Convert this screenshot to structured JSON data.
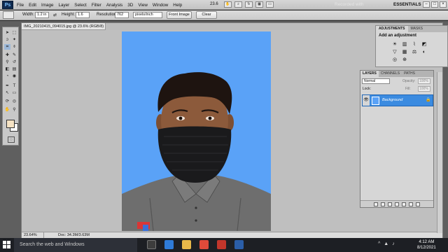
{
  "app": {
    "logo": "Ps",
    "menu": [
      "File",
      "Edit",
      "Image",
      "Layer",
      "Select",
      "Filter",
      "Analysis",
      "3D",
      "View",
      "Window",
      "Help"
    ],
    "zoom": "23.6",
    "watermark": "Recorded with",
    "workspace": "ESSENTIALS"
  },
  "options": {
    "width_label": "Width:",
    "width_value": "1.2 in",
    "height_label": "Height:",
    "height_value": "1.6",
    "resolution_label": "Resolution:",
    "resolution_value": "762",
    "resolution_unit": "pixels/inch",
    "front_image": "Front Image",
    "clear": "Clear"
  },
  "document": {
    "tab_title": "IMG_20210415_094015.jpg @ 23.6% (RGB/8) *",
    "status_zoom": "23.64%",
    "status_doc": "Doc: 34.3M/3.63M"
  },
  "adjustments": {
    "tabs": [
      "ADJUSTMENTS",
      "MASKS"
    ],
    "title": "Add an adjustment",
    "icons": [
      "brightness-icon",
      "levels-icon",
      "curves-icon",
      "exposure-icon",
      "vibrance-icon",
      "hue-icon",
      "balance-icon",
      "bw-icon",
      "photo-filter-icon",
      "mixer-icon"
    ]
  },
  "layers": {
    "tabs": [
      "LAYERS",
      "CHANNELS",
      "PATHS"
    ],
    "blend_mode": "Normal",
    "opacity_label": "Opacity:",
    "opacity_value": "100%",
    "lock_label": "Lock:",
    "fill_label": "Fill:",
    "fill_value": "100%",
    "items": [
      {
        "name": "Background"
      }
    ]
  },
  "taskbar": {
    "search": "Search the web and Windows",
    "time": "4:12 AM",
    "date": "8/12/2021"
  },
  "colors": {
    "photo_bg": "#5aa2f7",
    "selected_layer": "#3b8be0"
  }
}
